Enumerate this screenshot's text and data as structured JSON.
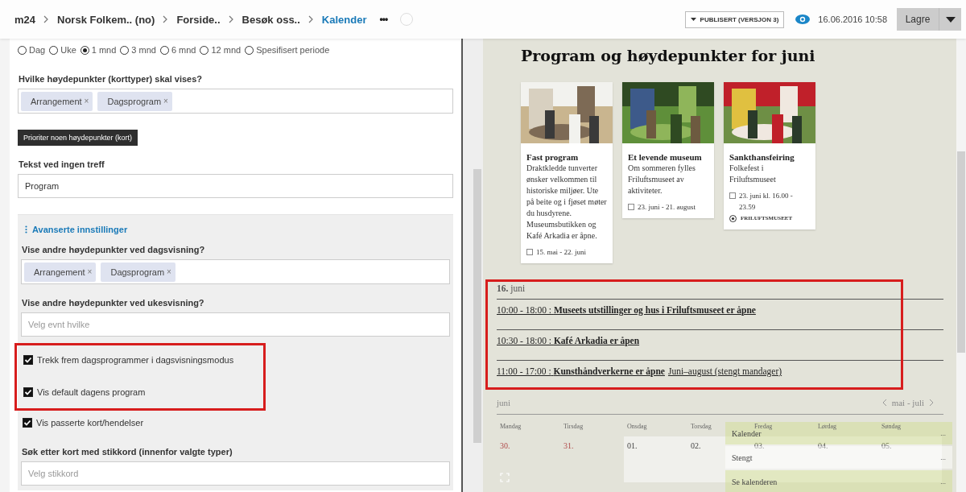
{
  "breadcrumbs": [
    {
      "label": "m24",
      "current": false
    },
    {
      "label": "Norsk Folkem.. (no)",
      "current": false
    },
    {
      "label": "Forside..",
      "current": false
    },
    {
      "label": "Besøk oss..",
      "current": false
    },
    {
      "label": "Kalender",
      "current": true
    }
  ],
  "more_label": "•••",
  "status_dropdown": {
    "label": "PUBLISERT (VERSJON 3)"
  },
  "timestamp": "16.06.2016 10:58",
  "save_button": {
    "label": "Lagre"
  },
  "editor": {
    "periods": [
      {
        "label": "Dag",
        "selected": false
      },
      {
        "label": "Uke",
        "selected": false
      },
      {
        "label": "1 mnd",
        "selected": true
      },
      {
        "label": "3 mnd",
        "selected": false
      },
      {
        "label": "6 mnd",
        "selected": false
      },
      {
        "label": "12 mnd",
        "selected": false
      },
      {
        "label": "Spesifisert periode",
        "selected": false
      }
    ],
    "types_label": "Hvilke høydepunkter (korttyper) skal vises?",
    "types_tags": [
      {
        "label": "Arrangement",
        "remove": "×"
      },
      {
        "label": "Dagsprogram",
        "remove": "×"
      }
    ],
    "priority_button": "Prioriter noen høydepunkter (kort)",
    "no_match_label": "Tekst ved ingen treff",
    "no_match_value": "Program",
    "advanced": {
      "title": "Avanserte innstillinger",
      "day_label": "Vise andre høydepunkter ved dagsvisning?",
      "day_tags": [
        {
          "label": "Arrangement",
          "remove": "×"
        },
        {
          "label": "Dagsprogram",
          "remove": "×"
        }
      ],
      "week_label": "Vise andre høydepunkter ved ukesvisning?",
      "week_placeholder": "Velg evnt hvilke",
      "checkbox_groups": [
        {
          "highlighted": true,
          "items": [
            {
              "label": "Trekk frem dagsprogrammer i dagsvisningsmodus",
              "checked": true
            },
            {
              "label": "Vis default dagens program",
              "checked": true
            }
          ]
        },
        {
          "highlighted": false,
          "items": [
            {
              "label": "Vis passerte kort/hendelser",
              "checked": true
            }
          ]
        }
      ],
      "keyword_label": "Søk etter kort med stikkord (innenfor valgte typer)",
      "keyword_placeholder": "Velg stikkord"
    }
  },
  "preview": {
    "title": "Program og høydepunkter for juni",
    "cards": [
      {
        "title": "Fast program",
        "text": "Draktkledde tunverter ønsker velkommen til historiske miljøer. Ute på beite og i fjøset møter du husdyrene. Museumsbutikken og Kafé Arkadia er åpne.",
        "date": "15. mai - 22. juni"
      },
      {
        "title": "Et levende museum",
        "text": "Om sommeren fylles Friluftsmuseet av aktiviteter.",
        "date": "23. juni - 21. august"
      },
      {
        "title": "Sankthansfeiring",
        "text": "Folkefest i Friluftsmuseet",
        "date": "23. juni kl. 16.00 - 23.59",
        "location": "FRILUFTSMUSEET"
      }
    ],
    "day_program": {
      "highlighted": true,
      "date": "**16.** juni",
      "events": [
        {
          "time": "10:00 - 18:00 :",
          "title": "Museets utstillinger og hus i Friluftsmuseet er åpne"
        },
        {
          "time": "10:30 - 18:00 :",
          "title": "Kafé Arkadia er åpen"
        },
        {
          "time": "11:00 - 17:00 :",
          "title": "Kunsthåndverkerne er åpne",
          "note": "Juni–august (stengt mandager)"
        }
      ]
    },
    "calendar": {
      "month": "juni",
      "range": "mai - juli",
      "weekdays": [
        "Mandag",
        "Tirsdag",
        "Onsdag",
        "Torsdag",
        "Fredag",
        "Lørdag",
        "Søndag"
      ],
      "dates": [
        {
          "label": "30.",
          "other_month": true
        },
        {
          "label": "31.",
          "other_month": true
        },
        {
          "label": "01.",
          "other_month": false
        },
        {
          "label": "02.",
          "other_month": false
        },
        {
          "label": "03.",
          "other_month": false
        },
        {
          "label": "04.",
          "other_month": false
        },
        {
          "label": "05.",
          "other_month": false
        }
      ],
      "popup": [
        {
          "label": "Kalender",
          "more": "...",
          "highlighted": true
        },
        {
          "label": "Stengt",
          "more": "...",
          "highlighted": false
        },
        {
          "label": "Se kalenderen",
          "more": "...",
          "highlighted": true
        }
      ]
    }
  }
}
